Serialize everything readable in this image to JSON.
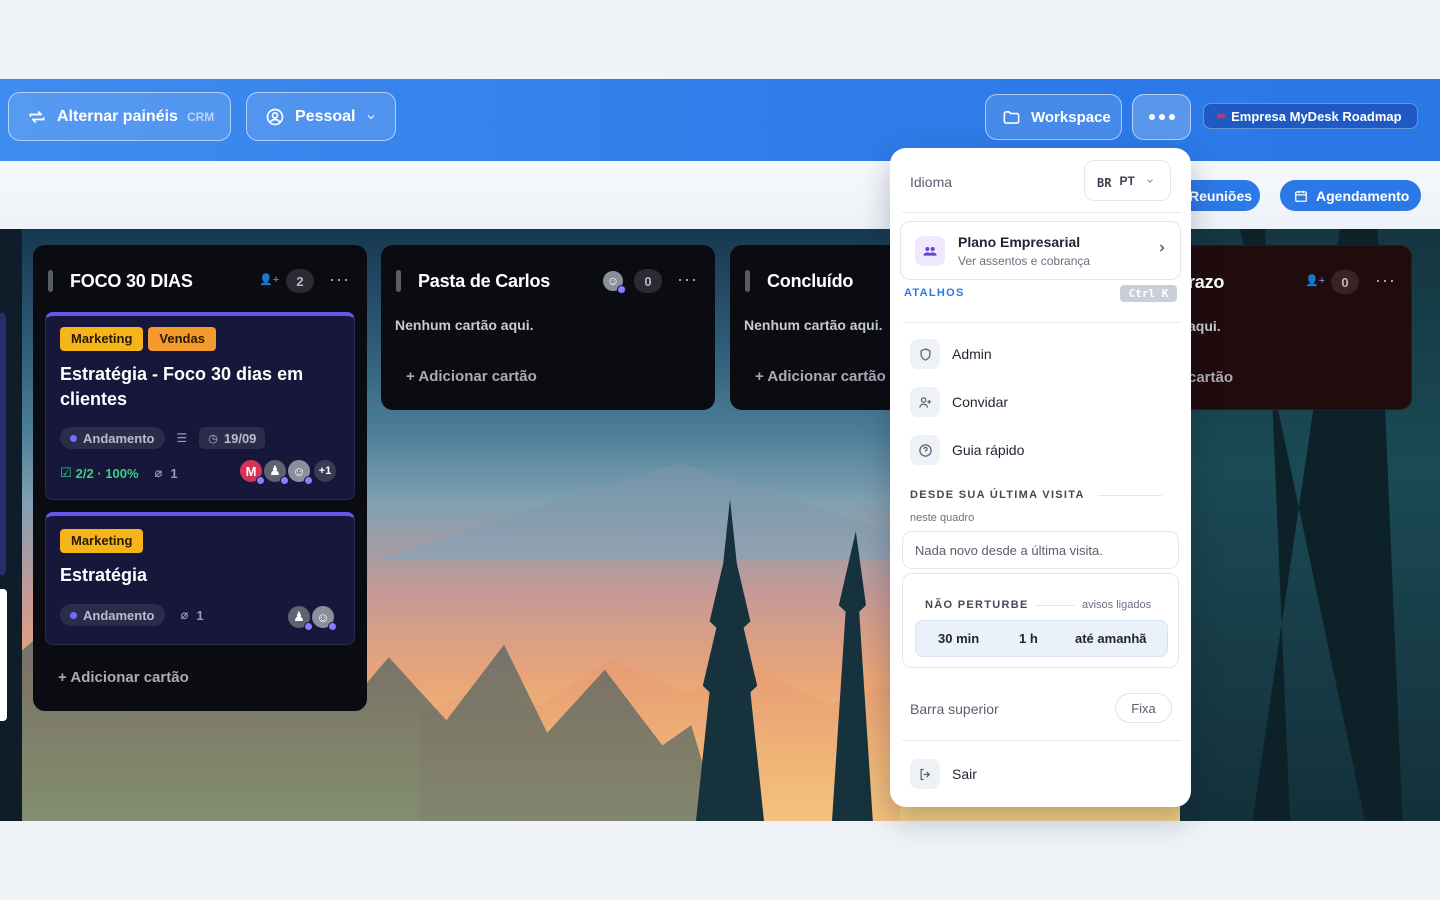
{
  "topbar": {
    "alternar_label": "Alternar painéis",
    "alternar_tag": "CRM",
    "pessoal_label": "Pessoal",
    "workspace_label": "Workspace",
    "roadmap_label": "Empresa MyDesk Roadmap"
  },
  "subbar": {
    "reunioes_label": "Reuniões",
    "agendamento_label": "Agendamento"
  },
  "columns": [
    {
      "title": "FOCO 30 DIAS",
      "count": "2",
      "add_label": "+ Adicionar cartão",
      "cards": [
        {
          "tags": [
            "Marketing",
            "Vendas"
          ],
          "title": "Estratégia - Foco 30 dias em clientes",
          "status": "Andamento",
          "date": "19/09",
          "checklist": "2/2 · 100%",
          "attachments": "1",
          "avatar_initial": "M",
          "avatar_more": "+1"
        },
        {
          "tags": [
            "Marketing"
          ],
          "title": "Estratégia",
          "status": "Andamento",
          "attachments": "1"
        }
      ]
    },
    {
      "title": "Pasta de Carlos",
      "count": "0",
      "empty_label": "Nenhum cartão aqui.",
      "add_label": "+ Adicionar cartão"
    },
    {
      "title": "Concluído",
      "empty_label": "Nenhum cartão aqui.",
      "add_label": "+ Adicionar cartão"
    },
    {
      "title_partial": "razo",
      "count": "0",
      "empty_partial": "aqui.",
      "add_partial": "cartão"
    }
  ],
  "panel": {
    "idioma_label": "Idioma",
    "lang_flag": "BR",
    "lang_code": "PT",
    "plan_title": "Plano Empresarial",
    "plan_sub": "Ver assentos e cobrança",
    "shortcuts_label": "ATALHOS",
    "shortcut_key": "Ctrl K",
    "menu": [
      {
        "label": "Admin"
      },
      {
        "label": "Convidar"
      },
      {
        "label": "Guia rápido"
      }
    ],
    "since_label": "DESDE SUA ÚLTIMA VISITA",
    "since_scope": "neste quadro",
    "since_empty": "Nada novo desde a última visita.",
    "dnd_label": "NÃO PERTURBE",
    "dnd_status": "avisos ligados",
    "dnd_options": [
      "30 min",
      "1 h",
      "até amanhã"
    ],
    "topbar_label": "Barra superior",
    "topbar_value": "Fixa",
    "logout_label": "Sair"
  },
  "colors": {
    "accent": "#2b79e7",
    "card_top": "#6757e8",
    "tag_marketing": "#f5b51a",
    "tag_vendas": "#f59a2c"
  }
}
